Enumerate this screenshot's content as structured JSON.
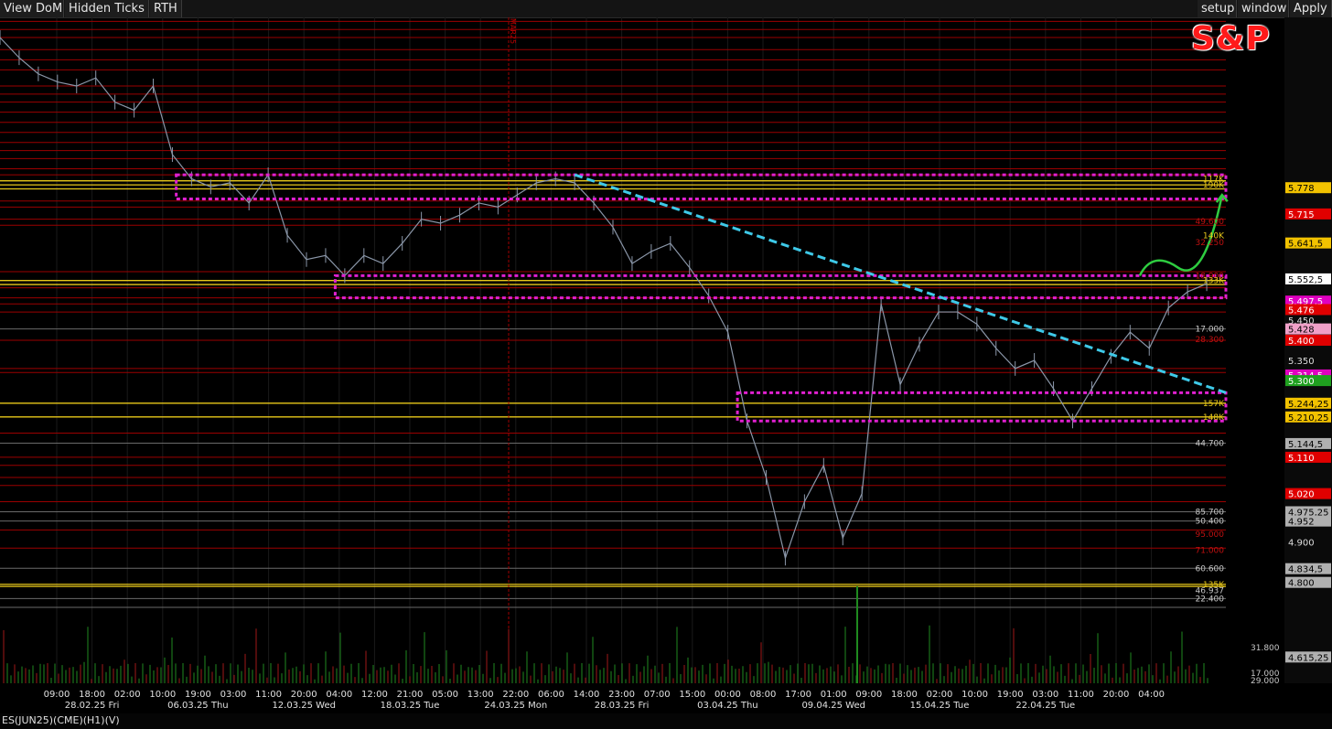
{
  "toolbar": {
    "view_dom": "View DoM",
    "hidden_ticks": "Hidden Ticks",
    "rth": "RTH",
    "setup": "setup",
    "window": "window",
    "apply": "Apply"
  },
  "logo_text": "S&P",
  "date_marker": "MAR25",
  "footer_label": "ES(JUN25)(CME)(H1)(V)",
  "colors": {
    "background": "#000000",
    "price_line": "#8a96a8",
    "trendline": "#3ec9e8",
    "zone_box": "#e020d0",
    "projection_arrow": "#2ecc40",
    "level_red": "#9b0000",
    "level_yellow": "#e8c81a",
    "volume_green": "#1f8a1f",
    "volume_red": "#a01818"
  },
  "chart_data": {
    "type": "line",
    "title": "",
    "xlabel": "",
    "ylabel": "",
    "ylim": [
      4550,
      6200
    ],
    "x_ticks": [
      {
        "label": "09:00",
        "sub": ""
      },
      {
        "label": "18:00",
        "sub": "28.02.25 Fri"
      },
      {
        "label": "02:00",
        "sub": ""
      },
      {
        "label": "10:00",
        "sub": ""
      },
      {
        "label": "19:00",
        "sub": "06.03.25 Thu"
      },
      {
        "label": "03:00",
        "sub": ""
      },
      {
        "label": "11:00",
        "sub": ""
      },
      {
        "label": "20:00",
        "sub": "12.03.25 Wed"
      },
      {
        "label": "04:00",
        "sub": ""
      },
      {
        "label": "12:00",
        "sub": ""
      },
      {
        "label": "21:00",
        "sub": "18.03.25 Tue"
      },
      {
        "label": "05:00",
        "sub": ""
      },
      {
        "label": "13:00",
        "sub": ""
      },
      {
        "label": "22:00",
        "sub": "24.03.25 Mon"
      },
      {
        "label": "06:00",
        "sub": ""
      },
      {
        "label": "14:00",
        "sub": ""
      },
      {
        "label": "23:00",
        "sub": "28.03.25 Fri"
      },
      {
        "label": "07:00",
        "sub": ""
      },
      {
        "label": "15:00",
        "sub": ""
      },
      {
        "label": "00:00",
        "sub": "03.04.25 Thu"
      },
      {
        "label": "08:00",
        "sub": ""
      },
      {
        "label": "17:00",
        "sub": ""
      },
      {
        "label": "01:00",
        "sub": "09.04.25 Wed"
      },
      {
        "label": "09:00",
        "sub": ""
      },
      {
        "label": "18:00",
        "sub": ""
      },
      {
        "label": "02:00",
        "sub": "15.04.25 Tue"
      },
      {
        "label": "10:00",
        "sub": ""
      },
      {
        "label": "19:00",
        "sub": ""
      },
      {
        "label": "03:00",
        "sub": "22.04.25 Tue"
      },
      {
        "label": "11:00",
        "sub": ""
      },
      {
        "label": "20:00",
        "sub": ""
      },
      {
        "label": "04:00",
        "sub": ""
      }
    ],
    "price_series": [
      [
        0,
        6150
      ],
      [
        1,
        6100
      ],
      [
        2,
        6060
      ],
      [
        3,
        6040
      ],
      [
        4,
        6030
      ],
      [
        5,
        6050
      ],
      [
        6,
        5990
      ],
      [
        7,
        5970
      ],
      [
        8,
        6030
      ],
      [
        9,
        5860
      ],
      [
        10,
        5800
      ],
      [
        11,
        5780
      ],
      [
        12,
        5790
      ],
      [
        13,
        5740
      ],
      [
        14,
        5810
      ],
      [
        15,
        5660
      ],
      [
        16,
        5600
      ],
      [
        17,
        5610
      ],
      [
        18,
        5560
      ],
      [
        19,
        5610
      ],
      [
        20,
        5590
      ],
      [
        21,
        5640
      ],
      [
        22,
        5700
      ],
      [
        23,
        5690
      ],
      [
        24,
        5710
      ],
      [
        25,
        5740
      ],
      [
        26,
        5730
      ],
      [
        27,
        5760
      ],
      [
        28,
        5790
      ],
      [
        29,
        5800
      ],
      [
        30,
        5790
      ],
      [
        31,
        5740
      ],
      [
        32,
        5680
      ],
      [
        33,
        5590
      ],
      [
        34,
        5620
      ],
      [
        35,
        5640
      ],
      [
        36,
        5580
      ],
      [
        37,
        5510
      ],
      [
        38,
        5420
      ],
      [
        39,
        5200
      ],
      [
        40,
        5060
      ],
      [
        41,
        4860
      ],
      [
        42,
        5000
      ],
      [
        43,
        5090
      ],
      [
        44,
        4910
      ],
      [
        45,
        5020
      ],
      [
        46,
        5490
      ],
      [
        47,
        5290
      ],
      [
        48,
        5390
      ],
      [
        49,
        5470
      ],
      [
        50,
        5470
      ],
      [
        51,
        5440
      ],
      [
        52,
        5380
      ],
      [
        53,
        5330
      ],
      [
        54,
        5350
      ],
      [
        55,
        5280
      ],
      [
        56,
        5200
      ],
      [
        57,
        5280
      ],
      [
        58,
        5360
      ],
      [
        59,
        5420
      ],
      [
        60,
        5380
      ],
      [
        61,
        5480
      ],
      [
        62,
        5520
      ],
      [
        63,
        5540
      ]
    ],
    "trendline": {
      "from": [
        30,
        5810
      ],
      "to": [
        64,
        5270
      ]
    },
    "zones": [
      {
        "from_x": 9.2,
        "to_x": 64,
        "top": 5810,
        "bottom": 5750
      },
      {
        "from_x": 17.5,
        "to_x": 64,
        "top": 5560,
        "bottom": 5505
      },
      {
        "from_x": 38.5,
        "to_x": 64,
        "top": 5270,
        "bottom": 5200
      }
    ],
    "projection": {
      "from": [
        59.5,
        5560
      ],
      "mid": [
        61.5,
        5580
      ],
      "to": [
        63.8,
        5760
      ]
    },
    "level_labels": [
      {
        "text": "117K",
        "y": 5800,
        "color": "#e8c81a"
      },
      {
        "text": "190K",
        "y": 5785,
        "color": "#e8c81a"
      },
      {
        "text": "49.600",
        "y": 5695,
        "color": "#c01010"
      },
      {
        "text": "140K",
        "y": 5660,
        "color": "#e8c81a"
      },
      {
        "text": "32.250",
        "y": 5643,
        "color": "#c01010"
      },
      {
        "text": "18.900",
        "y": 5560,
        "color": "#c01010"
      },
      {
        "text": "133K",
        "y": 5548,
        "color": "#e8c81a"
      },
      {
        "text": "17.000",
        "y": 5428,
        "color": "#c8c8c8"
      },
      {
        "text": "28.300",
        "y": 5402,
        "color": "#c01010"
      },
      {
        "text": "157K",
        "y": 5244,
        "color": "#e8c81a"
      },
      {
        "text": "148K",
        "y": 5210,
        "color": "#e8c81a"
      },
      {
        "text": "44.700",
        "y": 5145,
        "color": "#c8c8c8"
      },
      {
        "text": "85.700",
        "y": 4975,
        "color": "#c8c8c8"
      },
      {
        "text": "50.400",
        "y": 4952,
        "color": "#c8c8c8"
      },
      {
        "text": "95.000",
        "y": 4920,
        "color": "#c01010"
      },
      {
        "text": "71.000",
        "y": 4880,
        "color": "#c01010"
      },
      {
        "text": "60.600",
        "y": 4835,
        "color": "#c8c8c8"
      },
      {
        "text": "135K",
        "y": 4795,
        "color": "#e8c81a"
      },
      {
        "text": "46.937",
        "y": 4780,
        "color": "#c8c8c8"
      },
      {
        "text": "22.400",
        "y": 4760,
        "color": "#c8c8c8"
      }
    ],
    "price_axis_labels": [
      {
        "text": "5.778",
        "y": 5778,
        "bg": "#f2c200",
        "fg": "#000"
      },
      {
        "text": "5.715",
        "y": 5713,
        "bg": "#e00000",
        "fg": "#fff"
      },
      {
        "text": "5.641,5",
        "y": 5641,
        "bg": "#f2c200",
        "fg": "#000"
      },
      {
        "text": "5.552,5",
        "y": 5552,
        "bg": "#ffffff",
        "fg": "#000"
      },
      {
        "text": "5.497,5",
        "y": 5497,
        "bg": "#e000c0",
        "fg": "#fff"
      },
      {
        "text": "5.476",
        "y": 5476,
        "bg": "#e00000",
        "fg": "#fff"
      },
      {
        "text": "5.450",
        "y": 5450,
        "bg": "",
        "fg": "#ddd"
      },
      {
        "text": "5.428",
        "y": 5428,
        "bg": "#f0a0c8",
        "fg": "#000"
      },
      {
        "text": "5.400",
        "y": 5400,
        "bg": "#e00000",
        "fg": "#fff"
      },
      {
        "text": "5.350",
        "y": 5350,
        "bg": "",
        "fg": "#ddd"
      },
      {
        "text": "5.314,5",
        "y": 5314,
        "bg": "#e000c0",
        "fg": "#fff"
      },
      {
        "text": "5.300",
        "y": 5300,
        "bg": "#1fa01f",
        "fg": "#fff"
      },
      {
        "text": "5.244,25",
        "y": 5244,
        "bg": "#f2c200",
        "fg": "#000"
      },
      {
        "text": "5.210,25",
        "y": 5210,
        "bg": "#f2c200",
        "fg": "#000"
      },
      {
        "text": "5.144,5",
        "y": 5144,
        "bg": "#b0b0b0",
        "fg": "#000"
      },
      {
        "text": "5.110",
        "y": 5110,
        "bg": "#e00000",
        "fg": "#fff"
      },
      {
        "text": "5.020",
        "y": 5020,
        "bg": "#e00000",
        "fg": "#fff"
      },
      {
        "text": "4.975,25",
        "y": 4975,
        "bg": "#b0b0b0",
        "fg": "#000"
      },
      {
        "text": "4.952",
        "y": 4952,
        "bg": "#b0b0b0",
        "fg": "#000"
      },
      {
        "text": "4.900",
        "y": 4900,
        "bg": "",
        "fg": "#ddd"
      },
      {
        "text": "4.834,5",
        "y": 4834,
        "bg": "#b0b0b0",
        "fg": "#000"
      },
      {
        "text": "4.800",
        "y": 4800,
        "bg": "#b0b0b0",
        "fg": "#000"
      },
      {
        "text": "4.615,25",
        "y": 4615,
        "bg": "#b0b0b0",
        "fg": "#000"
      }
    ],
    "volume_labels": [
      "31.800",
      "17.000",
      "29.000"
    ],
    "red_levels": [
      6190,
      6170,
      6150,
      6120,
      6095,
      6070,
      6030,
      6010,
      5990,
      5965,
      5940,
      5915,
      5890,
      5870,
      5850,
      5825,
      5810,
      5745,
      5730,
      5700,
      5685,
      5570,
      5530,
      5505,
      5490,
      5470,
      5400,
      5330,
      5320,
      5170,
      5110,
      5090,
      5060,
      5040,
      5000,
      4930,
      4885
    ],
    "yellow_levels": [
      5795,
      5785,
      5775,
      5548,
      5538,
      5244,
      5210,
      4795,
      4790
    ],
    "gray_levels": [
      5428,
      5145,
      4975,
      4952,
      4835,
      4760,
      4738
    ]
  }
}
